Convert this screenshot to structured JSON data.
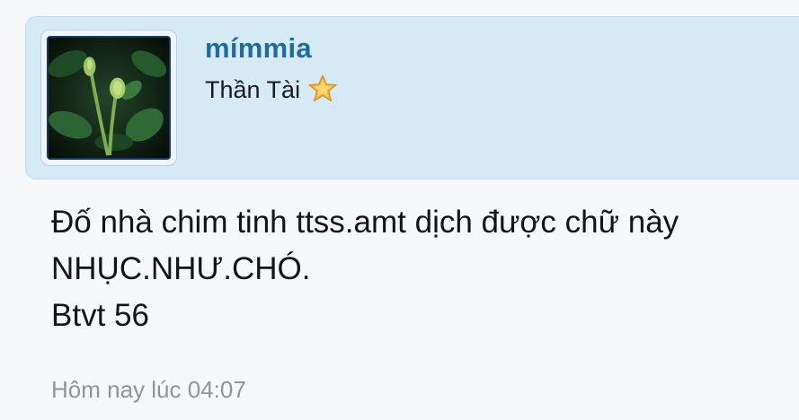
{
  "post": {
    "user": {
      "username": "mímmia",
      "title": "Thần Tài",
      "title_icon": "star-icon",
      "avatar": "avatar-image"
    },
    "message": {
      "lines": [
        "Đố nhà chim tinh ttss.amt dịch được chữ này",
        "NHỤC.NHƯ.CHÓ.",
        "Btvt 56"
      ]
    },
    "timestamp": "Hôm nay lúc 04:07"
  },
  "colors": {
    "background": "#f5f7f9",
    "user_card": "#d6eaf5",
    "username": "#1f6b9c",
    "timestamp": "#8d949a",
    "star": "#f6b43a"
  }
}
